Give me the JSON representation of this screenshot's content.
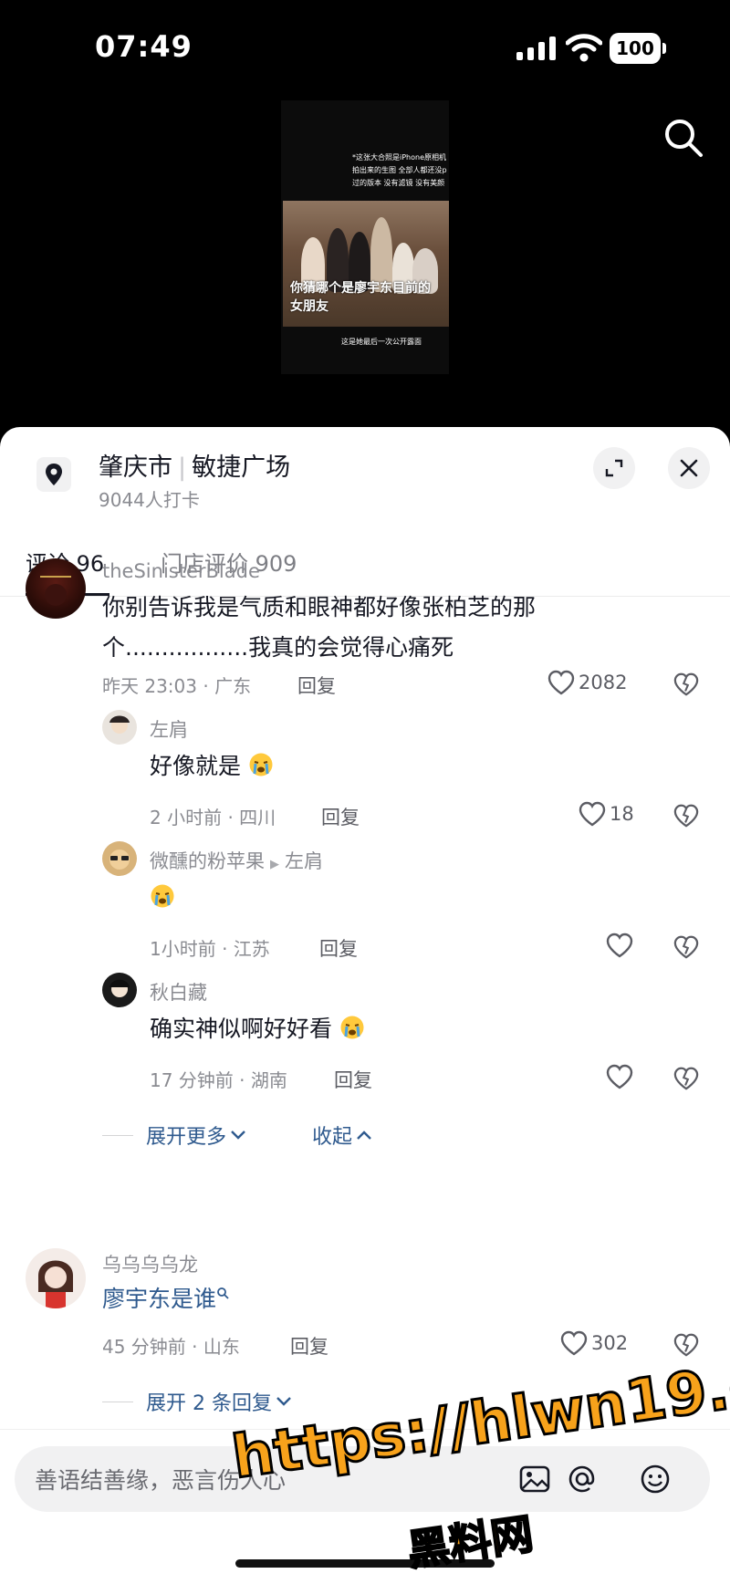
{
  "status_bar": {
    "time": "07:49",
    "battery": "100"
  },
  "video": {
    "caption_top": "*这张大合照是iPhone原相机拍出来的生图 全部人都还没p过的版本 没有滤镜 没有美颜",
    "caption_mid": "你猜哪个是廖宇东目前的女朋友",
    "caption_bottom": "这是她最后一次公开露面"
  },
  "location": {
    "city": "肇庆市",
    "place": "敏捷广场",
    "checkins": "9044人打卡"
  },
  "tabs": [
    {
      "label": "评论 96",
      "active": true
    },
    {
      "label": "门店评价 909",
      "active": false
    }
  ],
  "comments": [
    {
      "user": "theSinisterBlade",
      "text_line1": "你别告诉我是气质和眼神都好像张柏芝的那",
      "text_line2": "个.................我真的会觉得心痛死",
      "meta": "昨天 23:03 · 广东",
      "reply_label": "回复",
      "likes": "2082",
      "replies": [
        {
          "user": "左肩",
          "reply_to": "",
          "text": "好像就是",
          "meta": "2 小时前 · 四川",
          "reply_label": "回复",
          "likes": "18"
        },
        {
          "user": "微醺的粉苹果",
          "reply_to": "左肩",
          "text": "",
          "meta": "1小时前 · 江苏",
          "reply_label": "回复",
          "likes": ""
        },
        {
          "user": "秋白藏",
          "reply_to": "",
          "text": "确实神似啊好好看",
          "meta": "17 分钟前 · 湖南",
          "reply_label": "回复",
          "likes": ""
        }
      ],
      "expand_more": "展开更多",
      "collapse": "收起"
    },
    {
      "user": "乌乌乌乌龙",
      "text_line1": "廖宇东是谁",
      "meta": "45 分钟前 · 山东",
      "reply_label": "回复",
      "likes": "302",
      "expand_replies": "展开 2 条回复"
    }
  ],
  "input": {
    "placeholder": "善语结善缘，恶言伤人心"
  },
  "watermark": {
    "url": "https://hlwn19.com",
    "brand": "黑料网"
  },
  "colors": {
    "link": "#2f5a8e",
    "watermark": "#f7a21b",
    "emoji_yellow": "#ffc93c"
  }
}
